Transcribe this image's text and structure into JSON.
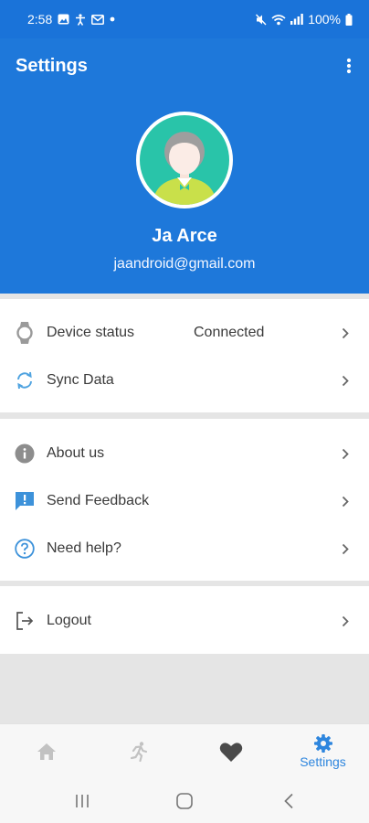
{
  "status_bar": {
    "time": "2:58",
    "battery": "100%",
    "left_icons": [
      "gallery-icon",
      "accessibility-icon",
      "mail-icon",
      "dot-icon"
    ],
    "right_icons": [
      "mute-icon",
      "wifi-icon",
      "signal-icon",
      "battery-icon"
    ]
  },
  "header": {
    "title": "Settings",
    "menu_icon": "more-vert-icon",
    "bg_color": "#1e78da"
  },
  "profile": {
    "name": "Ja Arce",
    "email": "jaandroid@gmail.com",
    "avatar_icon": "user-avatar-icon"
  },
  "sections": [
    {
      "items": [
        {
          "icon": "watch-icon",
          "label": "Device status",
          "value": "Connected"
        },
        {
          "icon": "sync-icon",
          "label": "Sync Data"
        }
      ]
    },
    {
      "items": [
        {
          "icon": "info-icon",
          "label": "About us"
        },
        {
          "icon": "feedback-icon",
          "label": "Send Feedback"
        },
        {
          "icon": "help-icon",
          "label": "Need help?"
        }
      ]
    },
    {
      "items": [
        {
          "icon": "logout-icon",
          "label": "Logout"
        }
      ]
    }
  ],
  "bottom_nav": {
    "items": [
      {
        "icon": "home-icon",
        "label": ""
      },
      {
        "icon": "run-icon",
        "label": ""
      },
      {
        "icon": "heart-icon",
        "label": ""
      },
      {
        "icon": "gear-icon",
        "label": "Settings",
        "active": true
      }
    ],
    "active_color": "#2e86de"
  },
  "system_nav": [
    "recents-icon",
    "home-button-icon",
    "back-icon"
  ]
}
